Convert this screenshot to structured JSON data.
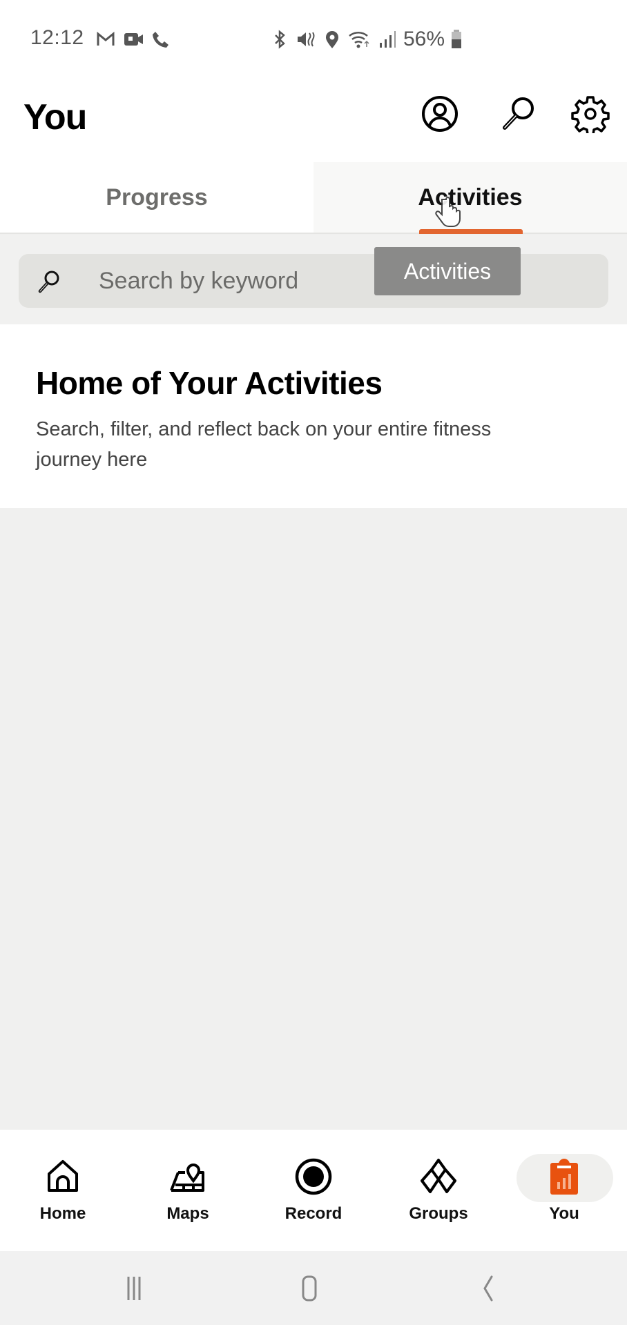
{
  "status_bar": {
    "time": "12:12",
    "left_icons": [
      "gmail-icon",
      "video-call-icon",
      "phone-icon"
    ],
    "right_icons": [
      "bluetooth-icon",
      "mute-icon",
      "location-icon",
      "wifi-icon",
      "signal-icon"
    ],
    "battery": "56%"
  },
  "header": {
    "title": "You",
    "actions": [
      {
        "name": "profile",
        "icon": "profile-icon"
      },
      {
        "name": "search",
        "icon": "search-icon"
      },
      {
        "name": "settings",
        "icon": "gear-icon"
      }
    ]
  },
  "tabs": [
    {
      "label": "Progress",
      "active": false
    },
    {
      "label": "Activities",
      "active": true
    }
  ],
  "search": {
    "placeholder": "Search by keyword",
    "value": ""
  },
  "tooltip": "Activities",
  "card": {
    "title": "Home of Your Activities",
    "description": "Search, filter, and reflect back on your entire fitness journey here"
  },
  "bottom_nav": [
    {
      "label": "Home",
      "icon": "home-icon",
      "selected": false
    },
    {
      "label": "Maps",
      "icon": "map-icon",
      "selected": false
    },
    {
      "label": "Record",
      "icon": "record-icon",
      "selected": false
    },
    {
      "label": "Groups",
      "icon": "groups-icon",
      "selected": false
    },
    {
      "label": "You",
      "icon": "you-clipboard-icon",
      "selected": true
    }
  ],
  "colors": {
    "accent": "#e8520f",
    "tab_underline": "#e2652f"
  },
  "system_nav": [
    "recent-apps",
    "home",
    "back"
  ]
}
